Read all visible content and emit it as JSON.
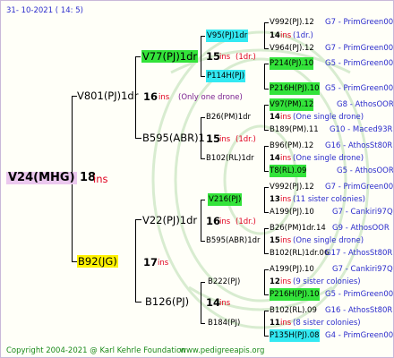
{
  "header": {
    "date": "31- 10-2021 ( 14: 5)"
  },
  "footer": {
    "copyright": "Copyright 2004-2021 @ Karl Kehrle Foundation",
    "site": "www.pedigreeapis.org"
  },
  "colors": {
    "ins_red": "#e0001f",
    "gen_blue": "#2c2ccc",
    "cyan": "#33e9f2",
    "green": "#33e33a",
    "yellow": "#fff200",
    "pink": "#ebc8ee"
  },
  "root": {
    "name": "V24(MHG)",
    "ins_num": "18",
    "ins": "ins"
  },
  "g1": [
    {
      "name": "V801(PJ)1dr",
      "ins_num": "16",
      "ins": "ins",
      "note": "(Only one drone)"
    },
    {
      "name": "B92(JG)",
      "ins_num": "17",
      "ins": "ins"
    }
  ],
  "g2": [
    {
      "name": "V77(PJ)1dr",
      "ins_num": "15",
      "ins": "ins",
      "note": "(1dr.)"
    },
    {
      "name": "B595(ABR)1",
      "ins_num": "15",
      "ins": "ins",
      "note": "(1dr.)"
    },
    {
      "name": "V22(PJ)1dr",
      "ins_num": "16",
      "ins": "ins",
      "note": "(1dr.)"
    },
    {
      "name": "B126(PJ)",
      "ins_num": "14",
      "ins": "ins"
    }
  ],
  "g3": [
    {
      "name": "V95(PJ)1dr",
      "ins_num": "14",
      "ins": "ins",
      "note": "(1dr.)"
    },
    {
      "name": "P114H(PJ)",
      "ins_num": "",
      "ins": "",
      "note": ""
    },
    {
      "name": "B26(PM)1dr",
      "ins_num": "14",
      "ins": "ins",
      "note": "(One single drone)"
    },
    {
      "name": "B102(RL)1dr",
      "ins_num": "14",
      "ins": "ins",
      "note": "(One single drone)"
    },
    {
      "name": "V216(PJ)",
      "ins_num": "13",
      "ins": "ins",
      "note": "(11 sister colonies)"
    },
    {
      "name": "B595(ABR)1dr",
      "ins_num": "15",
      "ins": "ins",
      "note": "(One single drone)"
    },
    {
      "name": "B222(PJ)",
      "ins_num": "12",
      "ins": "ins",
      "note": "(9 sister colonies)"
    },
    {
      "name": "B184(PJ)",
      "ins_num": "11",
      "ins": "ins",
      "note": "(8 sister colonies)"
    }
  ],
  "g4": [
    {
      "name": "V992(PJ).12",
      "gen": "G7 - PrimGreen00"
    },
    {
      "name": "V964(PJ).12",
      "gen": "G7 - PrimGreen00"
    },
    {
      "name": "P214(PJ).10",
      "gen": "G5 - PrimGreen00"
    },
    {
      "name": "P216H(PJ).10",
      "gen": "G5 - PrimGreen00"
    },
    {
      "name": "V97(PM).12",
      "gen": "G8 - AthosOOR"
    },
    {
      "name": "B189(PM).11",
      "gen": "G10 - Maced93R"
    },
    {
      "name": "B96(PM).12",
      "gen": "G16 - AthosSt80R"
    },
    {
      "name": "T8(RL).09",
      "gen": "G5 - AthosOOR"
    },
    {
      "name": "V992(PJ).12",
      "gen": "G7 - PrimGreen00"
    },
    {
      "name": "A199(PJ).10",
      "gen": "G7 - Cankiri97Q"
    },
    {
      "name": "B26(PM)1dr.14",
      "gen": "G9 - AthosOOR"
    },
    {
      "name": "B102(RL)1dr.06",
      "gen": "G17 - AthosSt80R"
    },
    {
      "name": "A199(PJ).10",
      "gen": "G7 - Cankiri97Q"
    },
    {
      "name": "P216H(PJ).10",
      "gen": "G5 - PrimGreen00"
    },
    {
      "name": "B102(RL).09",
      "gen": "G16 - AthosSt80R"
    },
    {
      "name": "P135H(PJ).08",
      "gen": "G4 - PrimGreen00"
    }
  ]
}
